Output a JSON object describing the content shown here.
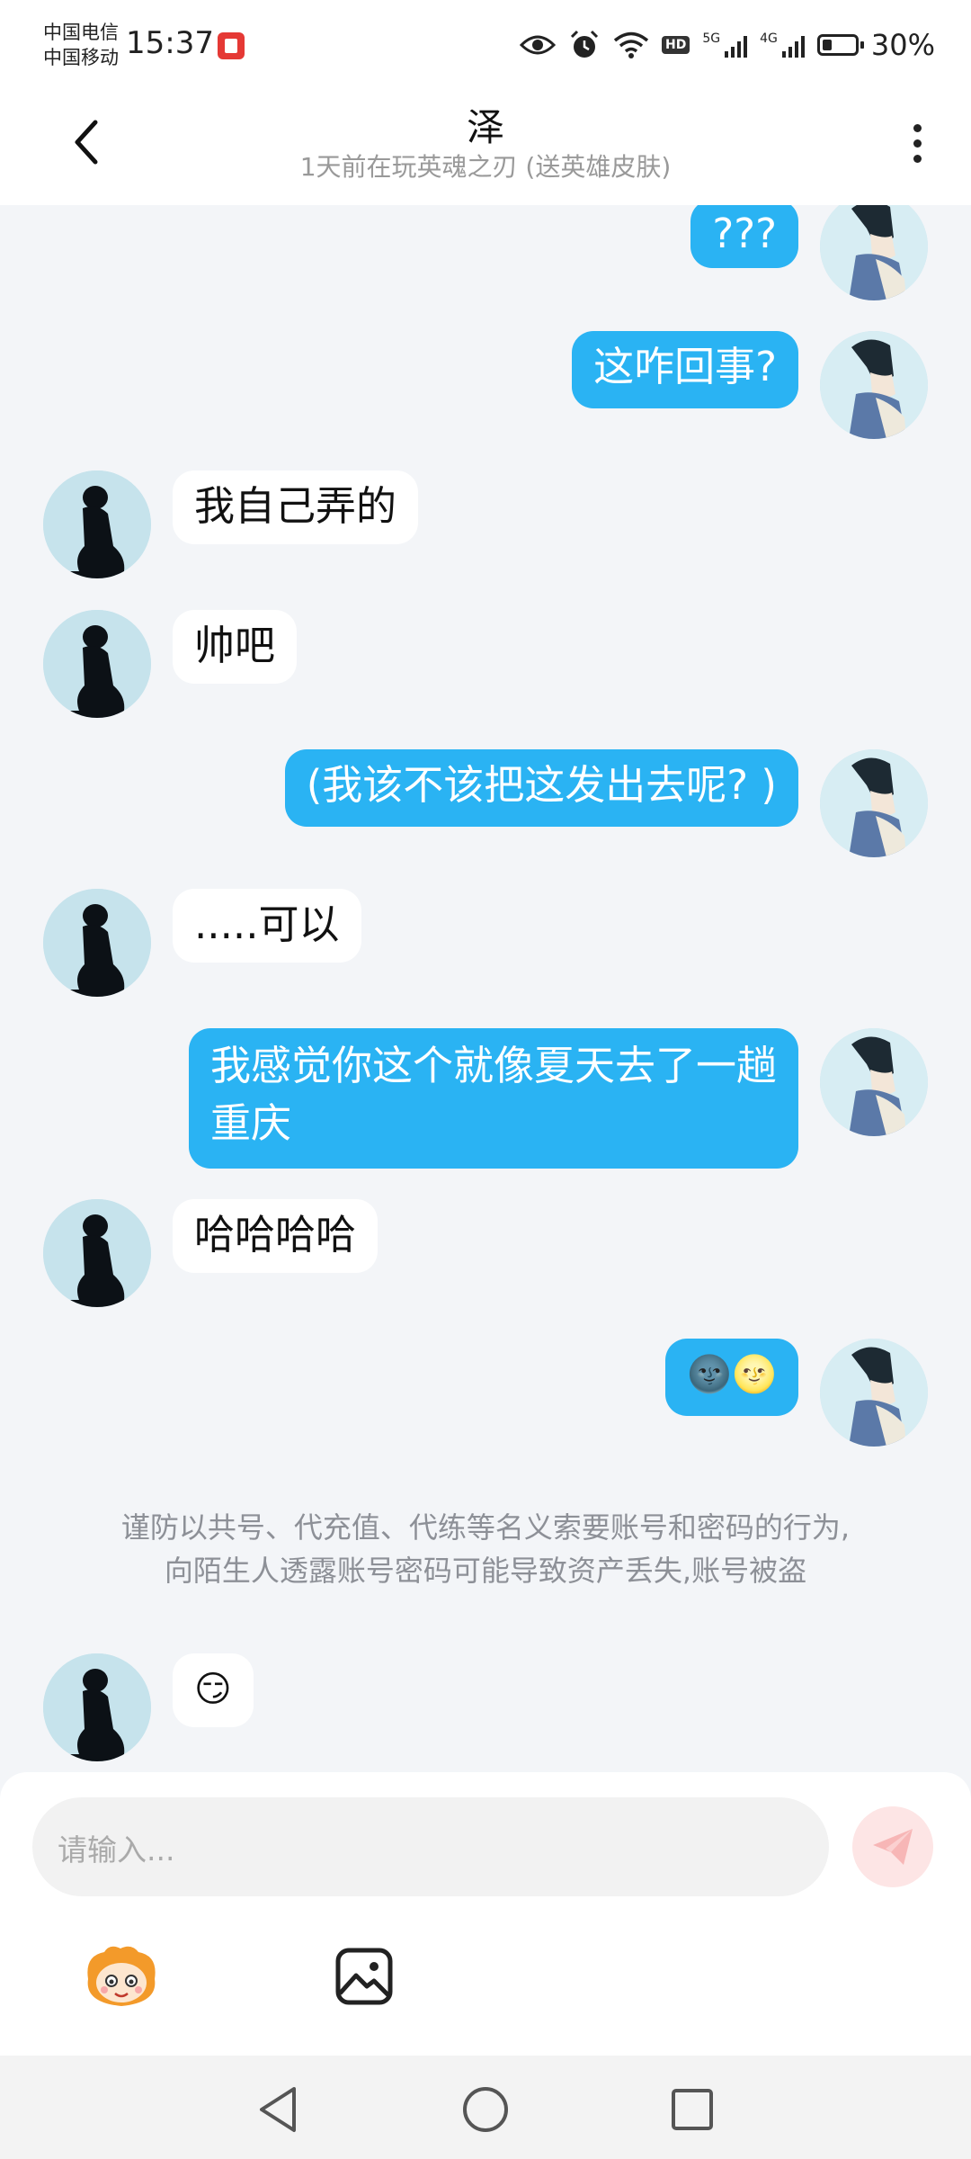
{
  "status_bar": {
    "carrier_1": "中国电信",
    "carrier_2": "中国移动",
    "time": "15:37",
    "hd": "HD",
    "net_5g": "5G",
    "net_4g": "4G",
    "battery_percent": "30%",
    "battery_level": 0.3
  },
  "header": {
    "back_icon": "chevron-left-icon",
    "title": "泽",
    "subtitle": "1天前在玩英魂之刃 (送英雄皮肤)",
    "more_icon": "more-vertical-icon"
  },
  "messages": [
    {
      "side": "right",
      "text": "???"
    },
    {
      "side": "right",
      "text": "这咋回事?"
    },
    {
      "side": "left",
      "text": "我自己弄的"
    },
    {
      "side": "left",
      "text": "帅吧"
    },
    {
      "side": "right",
      "text": "(我该不该把这发出去呢? )"
    },
    {
      "side": "left",
      "text": ".....可以"
    },
    {
      "side": "right",
      "text_line1": "我感觉你这个就像夏天去了一趟",
      "text_line2": "重庆"
    },
    {
      "side": "left",
      "text": "哈哈哈哈"
    },
    {
      "side": "right",
      "text": "🌚🌝"
    },
    {
      "side": "left",
      "text": "😏"
    }
  ],
  "notice": {
    "line1": "谨防以共号、代充值、代练等名义索要账号和密码的行为,",
    "line2": "向陌生人透露账号密码可能导致资产丢失,账号被盗"
  },
  "input": {
    "placeholder": "请输入...",
    "send_icon": "paper-plane-icon"
  },
  "toolbar": {
    "sticker_icon": "mascot-sticker-icon",
    "image_icon": "image-icon"
  },
  "nav": {
    "back_icon": "triangle-back-icon",
    "home_icon": "circle-home-icon",
    "recents_icon": "square-recents-icon"
  },
  "colors": {
    "my_bubble": "#2ab3f3",
    "their_bubble": "#ffffff",
    "chat_background": "#f3f5f8"
  }
}
